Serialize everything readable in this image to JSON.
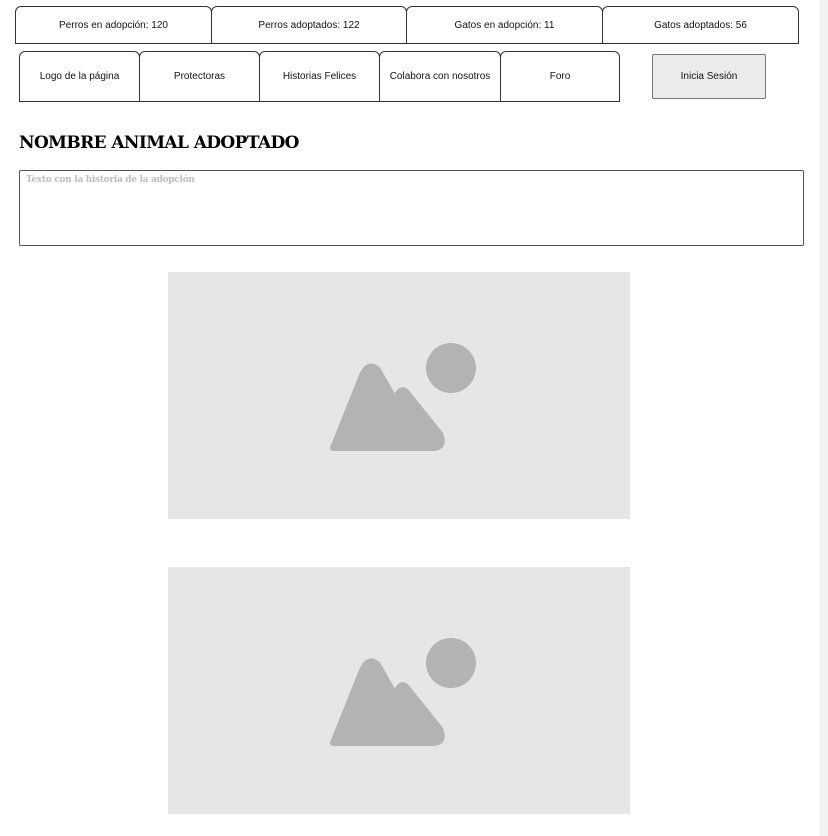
{
  "stats": [
    {
      "label": "Perros en adopción: 120"
    },
    {
      "label": "Perros adoptados: 122"
    },
    {
      "label": "Gatos en adopción: 11"
    },
    {
      "label": "Gatos adoptados: 56"
    }
  ],
  "nav": {
    "items": [
      {
        "label": "Logo de la página"
      },
      {
        "label": "Protectoras"
      },
      {
        "label": "Historias Felices"
      },
      {
        "label": "Colabora con nosotros"
      },
      {
        "label": "Foro"
      }
    ],
    "login_label": "Inicia Sesión"
  },
  "main": {
    "title": "NOMBRE ANIMAL ADOPTADO",
    "story_placeholder": "Texto con la historia de la adopción",
    "images": [
      {
        "icon": "image-placeholder-icon"
      },
      {
        "icon": "image-placeholder-icon"
      }
    ]
  },
  "colors": {
    "placeholder_bg": "#e6e6e6",
    "placeholder_icon": "#b3b3b3",
    "button_bg": "#ebebeb"
  }
}
